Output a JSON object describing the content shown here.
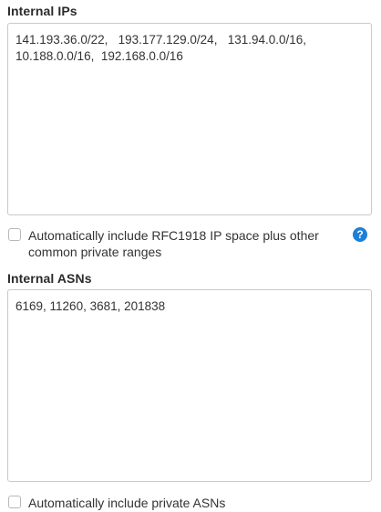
{
  "internal_ips": {
    "label": "Internal IPs",
    "value": "141.193.36.0/22,   193.177.129.0/24,   131.94.0.0/16,\n10.188.0.0/16,  192.168.0.0/16"
  },
  "rfc1918_option": {
    "label": "Automatically include RFC1918 IP space plus other common private ranges",
    "checked": false,
    "help_icon": "question-circle-icon",
    "help_glyph": "?"
  },
  "internal_asns": {
    "label": "Internal ASNs",
    "value": "6169, 11260, 3681, 201838"
  },
  "private_asn_option": {
    "label": "Automatically include private ASNs",
    "checked": false
  },
  "colors": {
    "help_icon": "#1d7fd6",
    "border": "#c9c9c9",
    "text": "#333333"
  }
}
